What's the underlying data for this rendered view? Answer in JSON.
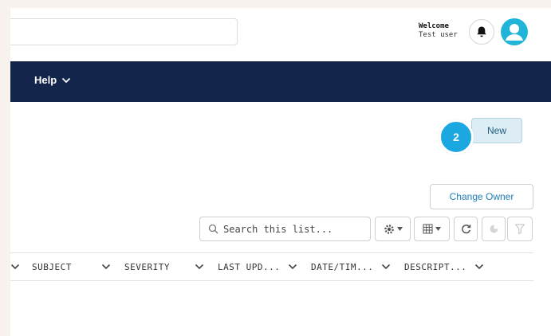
{
  "header": {
    "welcome_title": "Welcome",
    "welcome_user": "Test user",
    "icons": [
      "bell-icon",
      "user-avatar-icon"
    ]
  },
  "nav": {
    "help_label": "Help"
  },
  "actions": {
    "new_label": "New",
    "step_badge": "2",
    "change_owner_label": "Change Owner"
  },
  "list_toolbar": {
    "search_placeholder": "Search this list...",
    "icons": [
      "search-icon",
      "gear-icon",
      "table-icon",
      "refresh-icon",
      "chart-icon",
      "filter-icon"
    ]
  },
  "table": {
    "columns": [
      "SUBJECT",
      "SEVERITY",
      "LAST UPD...",
      "DATE/TIM...",
      "DESCRIPT..."
    ]
  },
  "colors": {
    "nav_bg": "#13254a",
    "accent": "#1ba7df",
    "link": "#1f7fb8"
  }
}
